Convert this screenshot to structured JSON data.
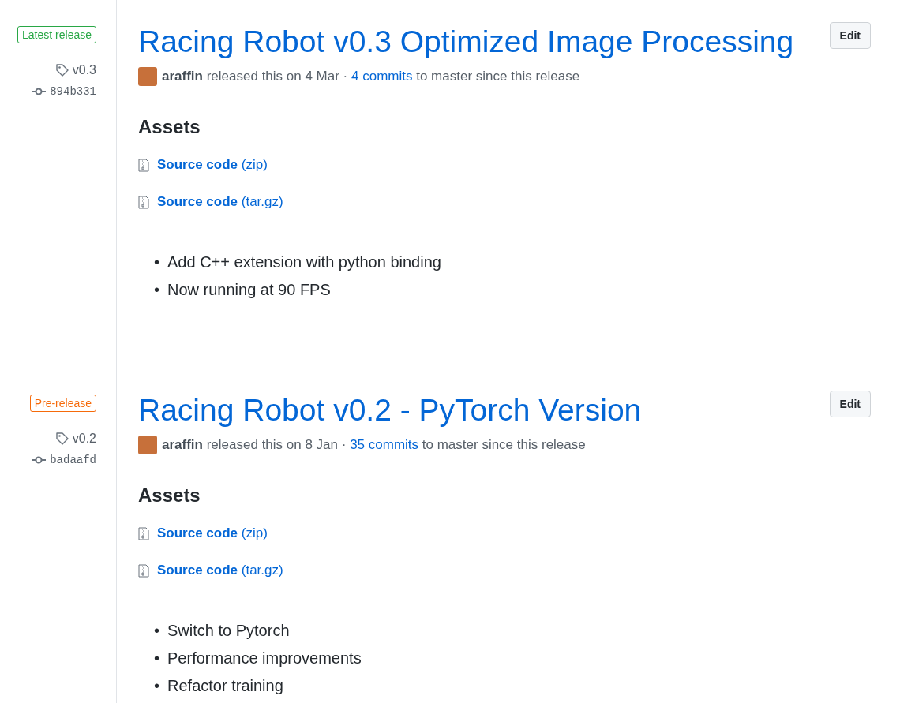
{
  "releases": [
    {
      "label": {
        "kind": "latest",
        "text": "Latest release"
      },
      "tag": "v0.3",
      "commit": "894b331",
      "title": "Racing Robot v0.3 Optimized Image Processing",
      "edit": "Edit",
      "meta_before": "**araffin** released this on 4 Mar ·",
      "commits": "4 commits",
      "meta_after": "to master since this release",
      "assets_heading": "Assets",
      "assets": [
        "**Source code** (zip)",
        "**Source code** (tar.gz)"
      ],
      "bullet": "•",
      "notes": [
        "Add C++ extension with python binding",
        "Now running at 90 FPS"
      ]
    },
    {
      "label": {
        "kind": "prerelease",
        "text": "Pre-release"
      },
      "tag": "v0.2",
      "commit": "badaafd",
      "title": "Racing Robot v0.2 - PyTorch Version",
      "edit": "Edit",
      "meta_before": "**araffin** released this on 8 Jan ·",
      "commits": "35 commits",
      "meta_after": "to master since this release",
      "assets_heading": "Assets",
      "assets": [
        "**Source code** (zip)",
        "**Source code** (tar.gz)"
      ],
      "bullet": "•",
      "notes": [
        "Switch to Pytorch",
        "Performance improvements",
        "Refactor training"
      ]
    }
  ]
}
